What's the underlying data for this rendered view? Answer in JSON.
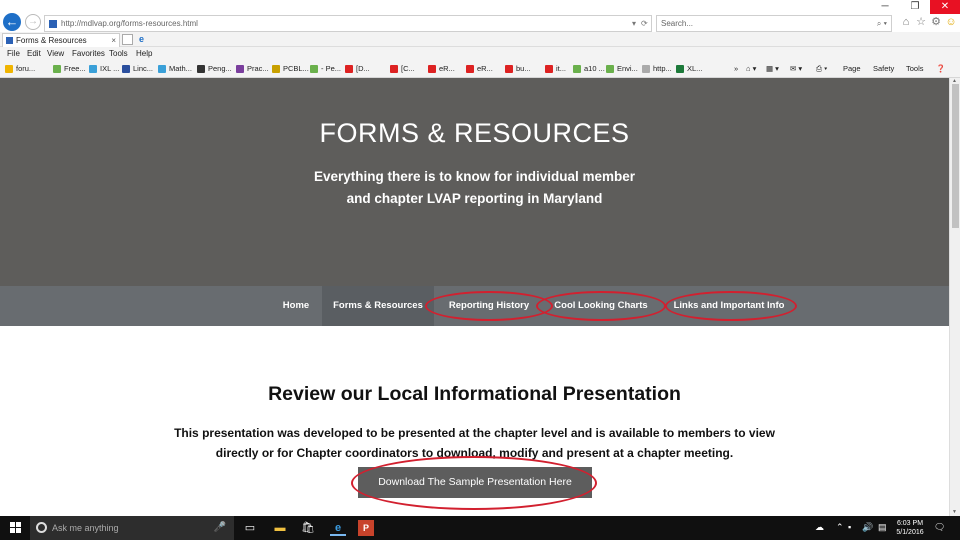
{
  "browser": {
    "url": "http://mdlvap.org/forms-resources.html",
    "search_placeholder": "Search...",
    "tab_title": "Forms & Resources",
    "tab_close": "×",
    "menu": [
      "File",
      "Edit",
      "View",
      "Favorites",
      "Tools",
      "Help"
    ],
    "favorites": [
      "foru...",
      "Free...",
      "IXL ...",
      "Linc...",
      "Math...",
      "Peng...",
      "Prac...",
      "PCBL...",
      "- Pe...",
      "[D...",
      "[C...",
      "eR...",
      "eR...",
      "bu...",
      "it...",
      "a10 ...",
      "Envi...",
      "http...",
      "XL..."
    ],
    "commands": [
      "Page",
      "Safety",
      "Tools"
    ],
    "window": {
      "minimize": "─",
      "restore": "❐",
      "close": "✕"
    }
  },
  "hero": {
    "title": "FORMS & RESOURCES",
    "subtitle_line1": "Everything there is to know for individual member",
    "subtitle_line2": "and chapter LVAP reporting in Maryland"
  },
  "nav": [
    {
      "label": "Home"
    },
    {
      "label": "Forms & Resources"
    },
    {
      "label": "Reporting History"
    },
    {
      "label": "Cool Looking Charts"
    },
    {
      "label": "Links and Important Info"
    }
  ],
  "content": {
    "section_title": "Review our Local Informational Presentation",
    "body_line1": "This presentation was developed to be presented at the chapter level and is available to members to view",
    "body_line2": "directly or for Chapter coordinators to download, modify and present at a chapter meeting.",
    "download_button": "Download The Sample Presentation Here"
  },
  "annotation_color": "#d2202f",
  "taskbar": {
    "search_placeholder": "Ask me anything",
    "time": "6:03 PM",
    "date": "5/1/2016"
  }
}
